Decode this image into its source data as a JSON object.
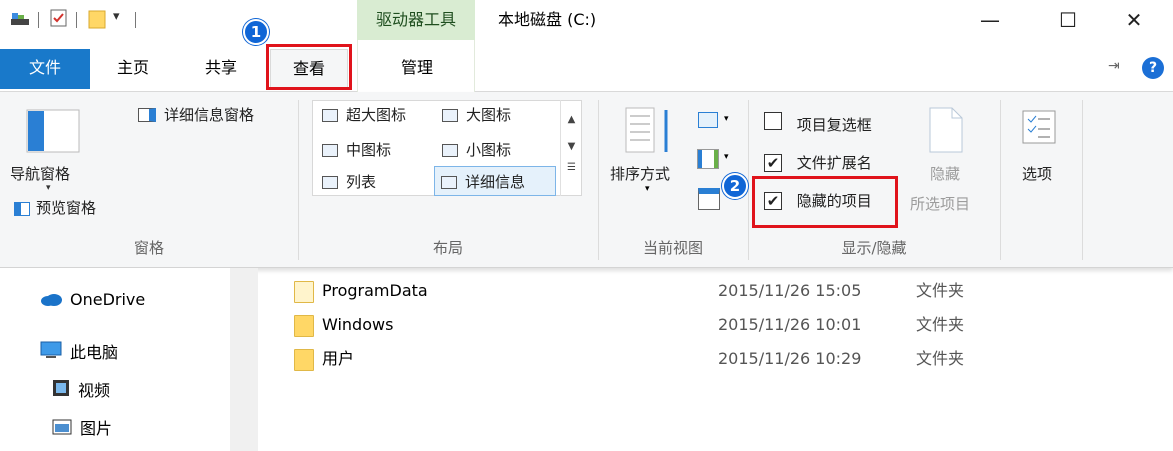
{
  "window": {
    "context_tab_label": "驱动器工具",
    "title": "本地磁盘 (C:)",
    "minimize": "—",
    "maximize": "☐",
    "close": "✕"
  },
  "tabs": {
    "file": "文件",
    "home": "主页",
    "share": "共享",
    "view": "查看",
    "manage": "管理"
  },
  "badges": {
    "one": "1",
    "two": "2"
  },
  "ribbon": {
    "panes": {
      "details_pane": "详细信息窗格",
      "nav_pane": "导航窗格",
      "preview_pane": "预览窗格",
      "group_label": "窗格"
    },
    "layout": {
      "extra_large_icons": "超大图标",
      "large_icons": "大图标",
      "medium_icons": "中图标",
      "small_icons": "小图标",
      "list": "列表",
      "details": "详细信息",
      "group_label": "布局"
    },
    "current_view": {
      "sort_by": "排序方式",
      "group_label": "当前视图"
    },
    "show_hide": {
      "item_checkboxes": "项目复选框",
      "item_checkboxes_checked": false,
      "file_extensions": "文件扩展名",
      "file_extensions_checked": true,
      "hidden_items": "隐藏的项目",
      "hidden_items_checked": true,
      "hide_selected_line1": "隐藏",
      "hide_selected_line2": "所选项目",
      "group_label": "显示/隐藏"
    },
    "options": "选项",
    "checkmark": "✔"
  },
  "nav": {
    "items": [
      {
        "label": "OneDrive"
      },
      {
        "label": "此电脑"
      },
      {
        "label": "视频"
      },
      {
        "label": "图片"
      }
    ]
  },
  "files": [
    {
      "name": "ProgramData",
      "date": "2015/11/26 15:05",
      "type": "文件夹"
    },
    {
      "name": "Windows",
      "date": "2015/11/26 10:01",
      "type": "文件夹"
    },
    {
      "name": "用户",
      "date": "2015/11/26 10:29",
      "type": "文件夹"
    }
  ],
  "colors": {
    "file_tab": "#1979ca",
    "context_band": "#d9ecd2",
    "highlight": "#e0131b",
    "badge": "#1066d6"
  }
}
